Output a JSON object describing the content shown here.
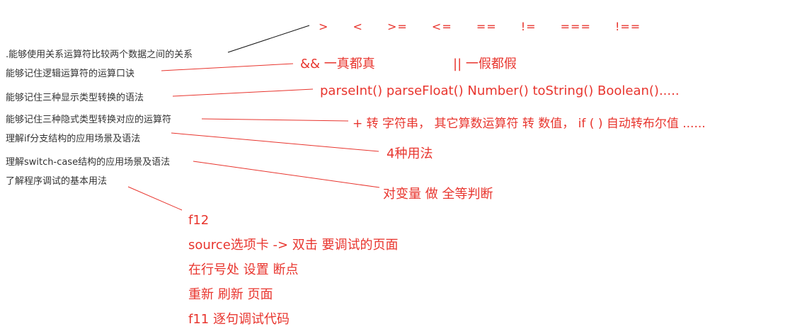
{
  "topics": [
    ".能够使用关系运算符比较两个数据之间的关系",
    "能够记住逻辑运算符的运算口诀",
    "能够记住三种显示类型转换的语法",
    "能够记住三种隐式类型转换对应的运算符",
    "理解if分支结构的应用场景及语法",
    "理解switch-case结构的应用场景及语法",
    "了解程序调试的基本用法"
  ],
  "relational_operators": [
    ">",
    "<",
    ">=",
    "<=",
    "==",
    "!=",
    "===",
    "!=="
  ],
  "logical_and": "&& 一真都真",
  "logical_or": "||  一假都假",
  "explicit_conversion": "parseInt()   parseFloat()    Number()    toString()       Boolean().....",
  "implicit_conversion": "+   转 字符串，    其它算数运算符 转 数值，  if ( ) 自动转布尔值 ......",
  "if_usage": "4种用法",
  "switch_note": "对变量 做 全等判断",
  "debug_steps": [
    "f12",
    "source选项卡 -> 双击 要调试的页面",
    "在行号处 设置 断点",
    "重新 刷新 页面",
    "f11 逐句调试代码"
  ],
  "colors": {
    "accent": "#e8352e",
    "text": "#333333",
    "line_black": "#111111"
  }
}
